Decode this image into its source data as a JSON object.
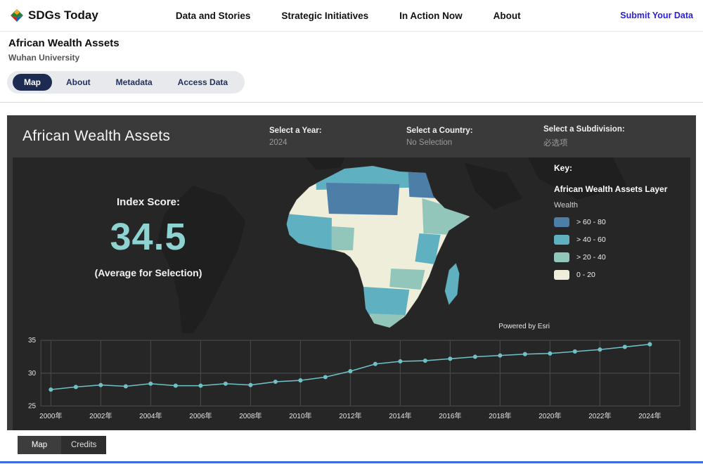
{
  "site_header": {
    "logo_text": "SDGs Today",
    "nav": [
      {
        "label": "Data and Stories"
      },
      {
        "label": "Strategic Initiatives"
      },
      {
        "label": "In Action Now"
      },
      {
        "label": "About"
      }
    ],
    "submit_link": "Submit Your Data"
  },
  "page": {
    "title": "African Wealth Assets",
    "subtitle": "Wuhan University",
    "tabs": [
      {
        "label": "Map",
        "active": true
      },
      {
        "label": "About",
        "active": false
      },
      {
        "label": "Metadata",
        "active": false
      },
      {
        "label": "Access Data",
        "active": false
      }
    ]
  },
  "dashboard": {
    "title": "African Wealth Assets",
    "selectors": [
      {
        "label": "Select a Year:",
        "value": "2024"
      },
      {
        "label": "Select a Country:",
        "value": "No Selection"
      },
      {
        "label": "Select a Subdivision:",
        "value": "必选项"
      }
    ],
    "index_score": {
      "label": "Index Score:",
      "value": "34.5",
      "caption": "(Average for Selection)"
    },
    "key": {
      "title": "Key:",
      "layer_title": "African Wealth Assets Layer",
      "field_label": "Wealth",
      "items": [
        {
          "label": "> 60 - 80",
          "color": "#4d7ea8"
        },
        {
          "label": "> 40 - 60",
          "color": "#5fb0c0"
        },
        {
          "label": "> 20 - 40",
          "color": "#93c6bb"
        },
        {
          "label": "0 - 20",
          "color": "#efeedb"
        }
      ]
    },
    "attribution": "Powered by Esri",
    "bottom_tabs": [
      {
        "label": "Map",
        "active": true
      },
      {
        "label": "Credits",
        "active": false
      }
    ]
  },
  "chart_data": {
    "type": "line",
    "title": "Index Score trend by year",
    "x": [
      2000,
      2001,
      2002,
      2003,
      2004,
      2005,
      2006,
      2007,
      2008,
      2009,
      2010,
      2011,
      2012,
      2013,
      2014,
      2015,
      2016,
      2017,
      2018,
      2019,
      2020,
      2021,
      2022,
      2023,
      2024
    ],
    "values": [
      27.5,
      27.9,
      28.2,
      28.0,
      28.4,
      28.1,
      28.1,
      28.4,
      28.2,
      28.7,
      28.9,
      29.4,
      30.3,
      31.4,
      31.8,
      31.9,
      32.2,
      32.5,
      32.7,
      32.9,
      33.0,
      33.3,
      33.6,
      34.0,
      34.4
    ],
    "x_ticks": [
      2000,
      2002,
      2004,
      2006,
      2008,
      2010,
      2012,
      2014,
      2016,
      2018,
      2020,
      2022,
      2024
    ],
    "x_tick_labels": [
      "2000年",
      "2002年",
      "2004年",
      "2006年",
      "2008年",
      "2010年",
      "2012年",
      "2014年",
      "2016年",
      "2018年",
      "2020年",
      "2022年",
      "2024年"
    ],
    "yticks": [
      25,
      30,
      35
    ],
    "ylim": [
      25,
      35
    ],
    "xlim": [
      1999.6,
      2025.2
    ],
    "line_color": "#6fc1c7",
    "grid_color": "#4b4b4b",
    "grid": true,
    "legend_position": "none"
  }
}
